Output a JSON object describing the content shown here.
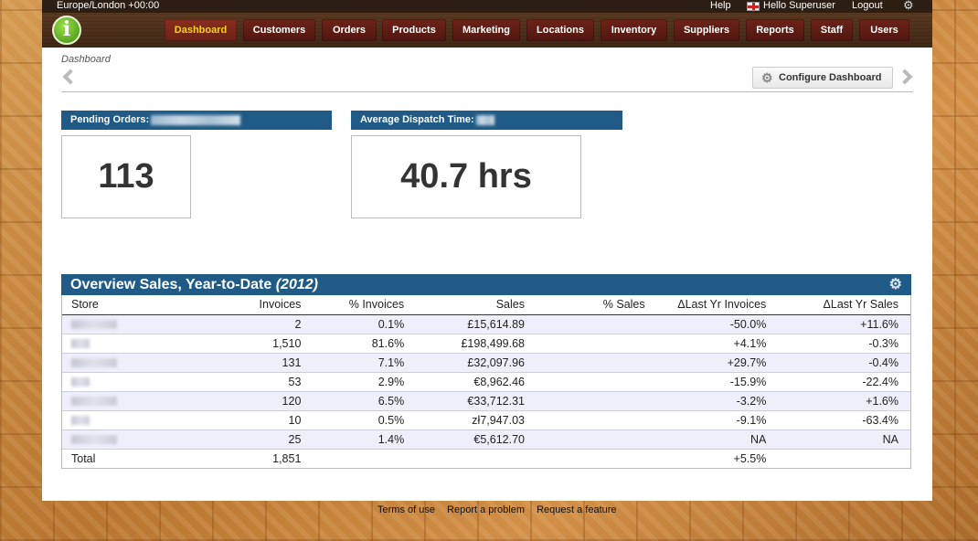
{
  "topbar": {
    "timezone": "Europe/London +00:00",
    "help": "Help",
    "hello": "Hello Superuser",
    "logout": "Logout"
  },
  "nav": {
    "items": [
      "Dashboard",
      "Customers",
      "Orders",
      "Products",
      "Marketing",
      "Locations",
      "Inventory",
      "Suppliers",
      "Reports",
      "Staff",
      "Users"
    ],
    "active": "Dashboard"
  },
  "breadcrumb": "Dashboard",
  "configure_button": "Configure Dashboard",
  "widgets": {
    "pending": {
      "title": "Pending Orders:",
      "value": "113"
    },
    "dispatch": {
      "title": "Average Dispatch Time:",
      "value": "40.7 hrs"
    }
  },
  "overview": {
    "title": "Overview Sales, Year-to-Date",
    "year": "(2012)",
    "columns": [
      "Store",
      "Invoices",
      "% Invoices",
      "Sales",
      "% Sales",
      "ΔLast Yr Invoices",
      "ΔLast Yr Sales"
    ],
    "rows": [
      {
        "invoices": "2",
        "pct_invoices": "0.1%",
        "sales": "£15,614.89",
        "pct_sales": "",
        "ly_invoices": "-50.0%",
        "ly_sales": "+11.6%"
      },
      {
        "invoices": "1,510",
        "pct_invoices": "81.6%",
        "sales": "£198,499.68",
        "pct_sales": "",
        "ly_invoices": "+4.1%",
        "ly_sales": "-0.3%"
      },
      {
        "invoices": "131",
        "pct_invoices": "7.1%",
        "sales": "£32,097.96",
        "pct_sales": "",
        "ly_invoices": "+29.7%",
        "ly_sales": "-0.4%"
      },
      {
        "invoices": "53",
        "pct_invoices": "2.9%",
        "sales": "€8,962.46",
        "pct_sales": "",
        "ly_invoices": "-15.9%",
        "ly_sales": "-22.4%"
      },
      {
        "invoices": "120",
        "pct_invoices": "6.5%",
        "sales": "€33,712.31",
        "pct_sales": "",
        "ly_invoices": "-3.2%",
        "ly_sales": "+1.6%"
      },
      {
        "invoices": "10",
        "pct_invoices": "0.5%",
        "sales": "zł7,947.03",
        "pct_sales": "",
        "ly_invoices": "-9.1%",
        "ly_sales": "-63.4%"
      },
      {
        "invoices": "25",
        "pct_invoices": "1.4%",
        "sales": "€5,612.70",
        "pct_sales": "",
        "ly_invoices": "NA",
        "ly_sales": "NA"
      }
    ],
    "total": {
      "label": "Total",
      "invoices": "1,851",
      "ly_invoices": "+5.5%"
    }
  },
  "footer": {
    "links": [
      "Terms of use",
      "Report a problem",
      "Request a feature"
    ]
  }
}
